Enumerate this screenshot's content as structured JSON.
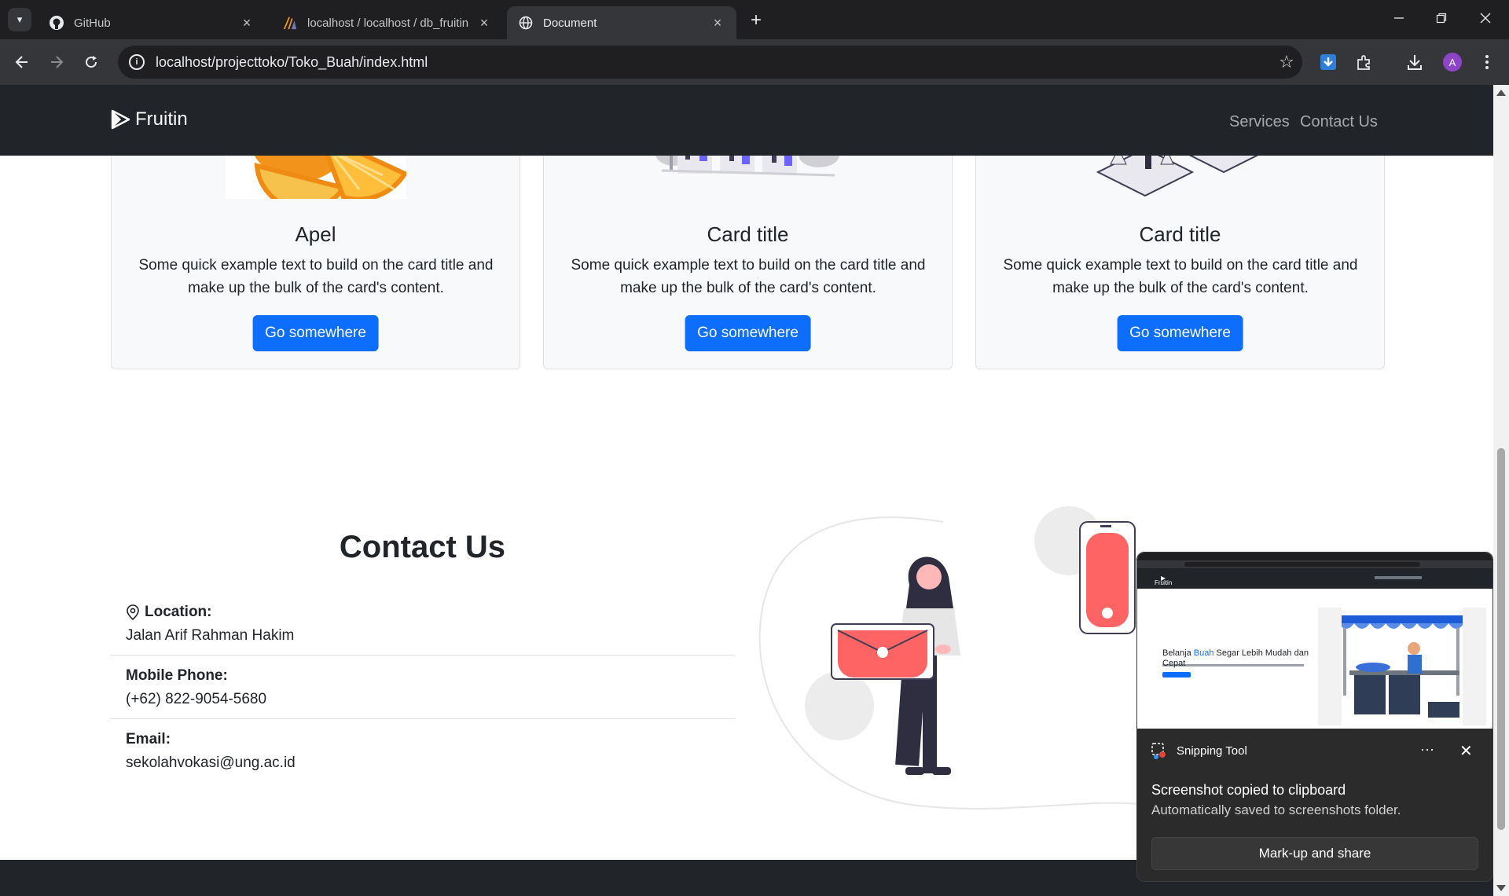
{
  "browser": {
    "tabs": [
      {
        "title": "GitHub",
        "icon": "github-icon"
      },
      {
        "title": "localhost / localhost / db_fruitin",
        "icon": "phpmyadmin-icon"
      },
      {
        "title": "Document",
        "icon": "globe-icon"
      }
    ],
    "url": "localhost/projecttoko/Toko_Buah/index.html",
    "profile_initial": "A"
  },
  "navbar": {
    "brand": "Fruitin",
    "links": [
      "Services",
      "Contact Us"
    ]
  },
  "cards": [
    {
      "title": "Apel",
      "text": "Some quick example text to build on the card title and make up the bulk of the card's content.",
      "button": "Go somewhere"
    },
    {
      "title": "Card title",
      "text": "Some quick example text to build on the card title and make up the bulk of the card's content.",
      "button": "Go somewhere"
    },
    {
      "title": "Card title",
      "text": "Some quick example text to build on the card title and make up the bulk of the card's content.",
      "button": "Go somewhere"
    }
  ],
  "contact": {
    "title": "Contact Us",
    "items": [
      {
        "label": "Location:",
        "value": "Jalan Arif Rahman Hakim"
      },
      {
        "label": "Mobile Phone:",
        "value": "(+62) 822-9054-5680"
      },
      {
        "label": "Email:",
        "value": "sekolahvokasi@ung.ac.id"
      }
    ]
  },
  "toast": {
    "app": "Snipping Tool",
    "message": "Screenshot copied to clipboard",
    "detail": "Automatically saved to screenshots folder.",
    "action": "Mark-up and share",
    "preview_headline_a": "Belanja ",
    "preview_headline_highlight": "Buah",
    "preview_headline_b": " Segar Lebih Mudah dan Cepat",
    "preview_brand": "Fruitin"
  },
  "colors": {
    "primary": "#0d6efd",
    "navbar": "#212529",
    "accent_red": "#ff6464",
    "accent_purple": "#6c63ff"
  }
}
